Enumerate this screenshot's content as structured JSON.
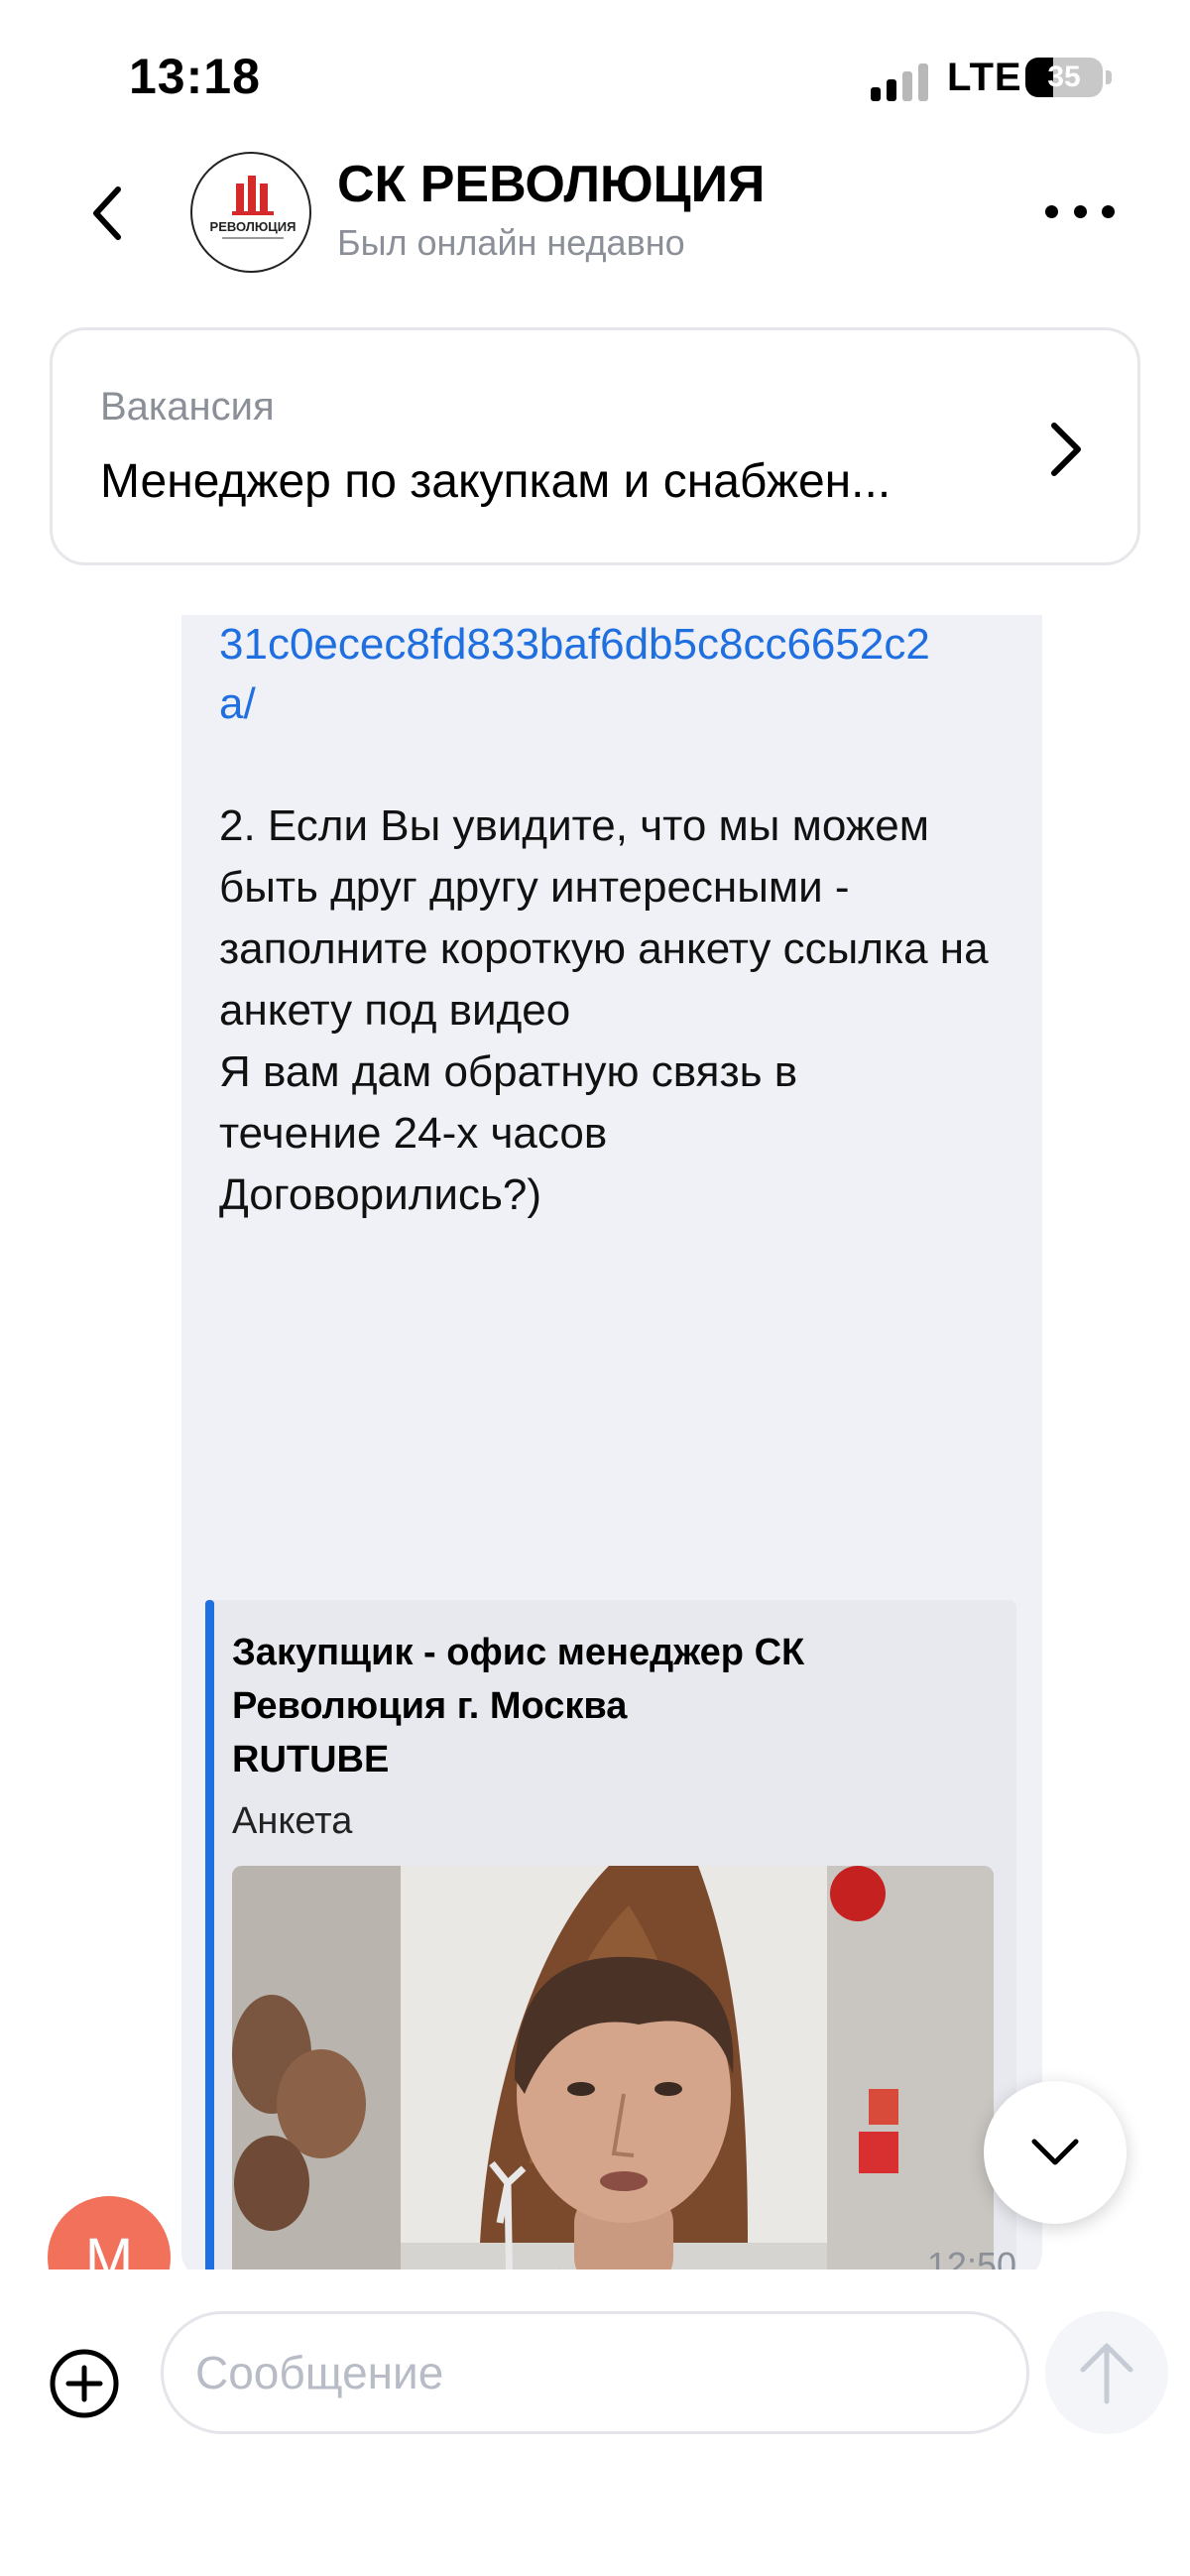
{
  "status_bar": {
    "time": "13:18",
    "network": "LTE",
    "battery": "35"
  },
  "header": {
    "title": "СК РЕВОЛЮЦИЯ",
    "subtitle": "Был онлайн недавно",
    "logo_text": "РЕВОЛЮЦИЯ"
  },
  "vacancy": {
    "label": "Вакансия",
    "title": "Менеджер по закупкам и снабжен..."
  },
  "message": {
    "link_line1": "31c0ecec8fd833baf6db5c8cc6652c2",
    "link_line2": "a/",
    "paragraph1": "2. Если Вы увидите, что мы можем быть друг другу интересными - заполните короткую анкету ссылка на анкету под видео",
    "paragraph2_line1": "Я вам дам обратную связь в",
    "paragraph2_line2": "течение 24-х часов",
    "paragraph2_line3": "Договорились?)",
    "time": "12:50",
    "preview": {
      "title": "Закупщик - офис менеджер СК Революция г. Москва",
      "site": "RUTUBE",
      "description": "Анкета"
    }
  },
  "user_avatar_letter": "М",
  "input": {
    "placeholder": "Сообщение"
  },
  "colors": {
    "link": "#1f6fe0",
    "bubble": "#eff1f6",
    "avatar": "#f2715b",
    "logo_red": "#d42a2a"
  }
}
